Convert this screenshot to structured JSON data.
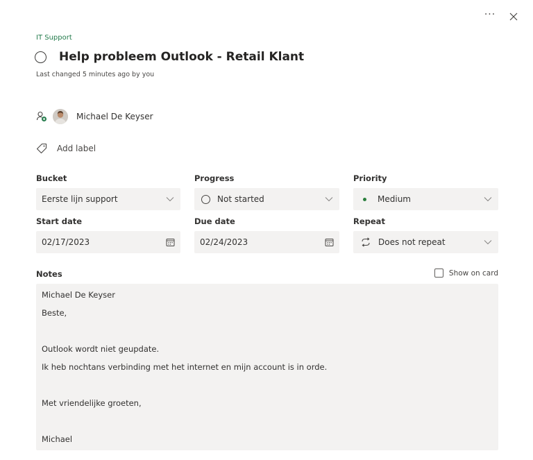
{
  "header": {
    "more_label": "···",
    "plan_name": "IT Support",
    "task_title": "Help probleem Outlook - Retail Klant",
    "last_changed": "Last changed 5 minutes ago by you"
  },
  "assignment": {
    "assignee_name": "Michael De Keyser"
  },
  "labels": {
    "add_label": "Add label"
  },
  "fields": {
    "bucket": {
      "label": "Bucket",
      "value": "Eerste lijn support"
    },
    "progress": {
      "label": "Progress",
      "value": "Not started"
    },
    "priority": {
      "label": "Priority",
      "value": "Medium"
    },
    "start_date": {
      "label": "Start date",
      "value": "02/17/2023"
    },
    "due_date": {
      "label": "Due date",
      "value": "02/24/2023"
    },
    "repeat": {
      "label": "Repeat",
      "value": "Does not repeat"
    }
  },
  "notes": {
    "label": "Notes",
    "show_on_card": "Show on card",
    "lines": [
      "Michael De Keyser",
      "Beste,",
      "",
      "Outlook wordt niet geupdate.",
      "Ik heb nochtans verbinding met het internet en mijn account is in orde.",
      "",
      "Met vriendelijke groeten,",
      "",
      "Michael"
    ]
  },
  "colors": {
    "plan_name": "#237b4b",
    "priority_dot": "#2a7f3d",
    "field_bg": "#f3f2f1"
  },
  "icons": {
    "more": "more-icon",
    "close": "close-icon",
    "complete": "circle-icon",
    "assign": "person-add-icon",
    "label": "tag-icon",
    "calendar": "calendar-icon",
    "repeat": "repeat-icon",
    "chevron": "chevron-down-icon"
  }
}
